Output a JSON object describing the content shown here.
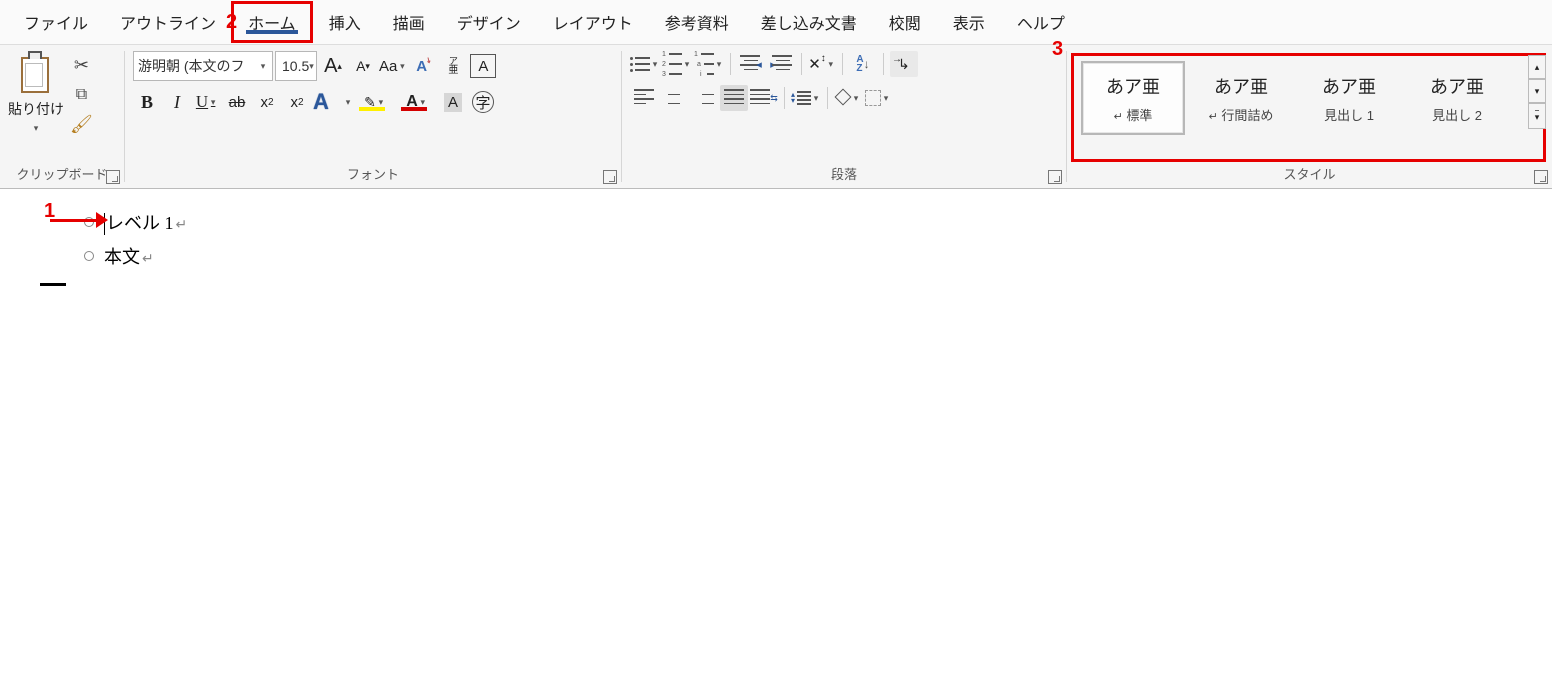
{
  "tabs": {
    "file": "ファイル",
    "outline": "アウトライン",
    "home": "ホーム",
    "insert": "挿入",
    "draw": "描画",
    "design": "デザイン",
    "layout": "レイアウト",
    "references": "参考資料",
    "mailings": "差し込み文書",
    "review": "校閲",
    "view": "表示",
    "help": "ヘルプ"
  },
  "clipboard": {
    "paste": "貼り付け",
    "group": "クリップボード"
  },
  "font": {
    "name": "游明朝 (本文のフ",
    "size": "10.5",
    "group": "フォント",
    "bold": "B",
    "italic": "I",
    "underline": "U",
    "strike": "ab",
    "sub": "x",
    "sup": "x",
    "clear": "A",
    "phon_top": "ア",
    "phon_bot": "亜",
    "box": "A",
    "bigA": "A",
    "circled": "字",
    "Aa": "Aa",
    "Aup": "A",
    "Adn": "A"
  },
  "para": {
    "group": "段落",
    "sortA": "A",
    "sortZ": "Z"
  },
  "styles": {
    "group": "スタイル",
    "items": [
      {
        "prev": "あア亜",
        "name": "標準"
      },
      {
        "prev": "あア亜",
        "name": "行間詰め"
      },
      {
        "prev": "あア亜",
        "name": "見出し 1"
      },
      {
        "prev": "あア亜",
        "name": "見出し 2"
      }
    ],
    "ret": "↵"
  },
  "doc": {
    "l1": "レベル 1",
    "l2": "本文",
    "ret": "↵"
  },
  "ann": {
    "n1": "1",
    "n2": "2",
    "n3": "3"
  },
  "glyph": {
    "down": "▾",
    "up": "▴",
    "check": ""
  }
}
